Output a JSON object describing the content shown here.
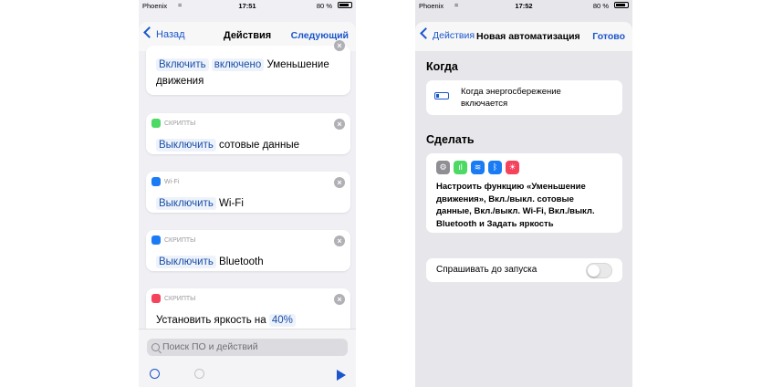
{
  "left": {
    "status": {
      "carrier": "Phoenix",
      "time": "17:51",
      "battery": "80 %"
    },
    "nav": {
      "back": "Назад",
      "title": "Действия",
      "next": "Следующий"
    },
    "cards": [
      {
        "category": "",
        "parts": [
          [
            "Включить",
            "t"
          ],
          [
            " ",
            ""
          ],
          [
            "включено",
            "t"
          ],
          [
            " Уменьшение движения",
            ""
          ]
        ]
      },
      {
        "category": "СКРИПТЫ",
        "icon_color": "#4cd964",
        "icon": "cellular-icon",
        "parts": [
          [
            "Выключить",
            "t"
          ],
          [
            " сотовые данные",
            ""
          ]
        ]
      },
      {
        "category": "Wi-Fi",
        "icon_color": "#1a7cf5",
        "icon": "wifi-icon",
        "parts": [
          [
            "Выключить",
            "t"
          ],
          [
            " Wi-Fi",
            ""
          ]
        ]
      },
      {
        "category": "СКРИПТЫ",
        "icon_color": "#1a7cf5",
        "icon": "bluetooth-icon",
        "parts": [
          [
            "Выключить",
            "t"
          ],
          [
            " Bluetooth",
            ""
          ]
        ]
      },
      {
        "category": "СКРИПТЫ",
        "icon_color": "#f5435b",
        "icon": "brightness-icon",
        "parts": [
          [
            "Установить яркость на ",
            ""
          ],
          [
            "40%",
            "t"
          ]
        ]
      }
    ],
    "search": {
      "placeholder": "Поиск ПО и действий"
    }
  },
  "right": {
    "status": {
      "carrier": "Phoenix",
      "time": "17:52",
      "battery": "80 %"
    },
    "nav": {
      "back": "Действия",
      "title": "Новая автоматизация",
      "done": "Готово"
    },
    "when_title": "Когда",
    "when_text": "Когда энергосбережение включается",
    "do_title": "Сделать",
    "do_text": "Настроить функцию «Уменьшение движения», Вкл./выкл. сотовые данные, Вкл./выкл. Wi-Fi, Вкл./выкл. Bluetooth и Задать яркость",
    "do_icons": [
      {
        "name": "settings-icon",
        "color": "#8e8e93",
        "glyph": "⚙"
      },
      {
        "name": "cellular-icon",
        "color": "#4cd964",
        "glyph": "ıl"
      },
      {
        "name": "wifi-icon",
        "color": "#1a7cf5",
        "glyph": "≋"
      },
      {
        "name": "bluetooth-icon",
        "color": "#1a7cf5",
        "glyph": "ᛒ"
      },
      {
        "name": "brightness-icon",
        "color": "#f5435b",
        "glyph": "☀"
      }
    ],
    "ask_label": "Спрашивать до запуска",
    "ask_toggle": false
  }
}
